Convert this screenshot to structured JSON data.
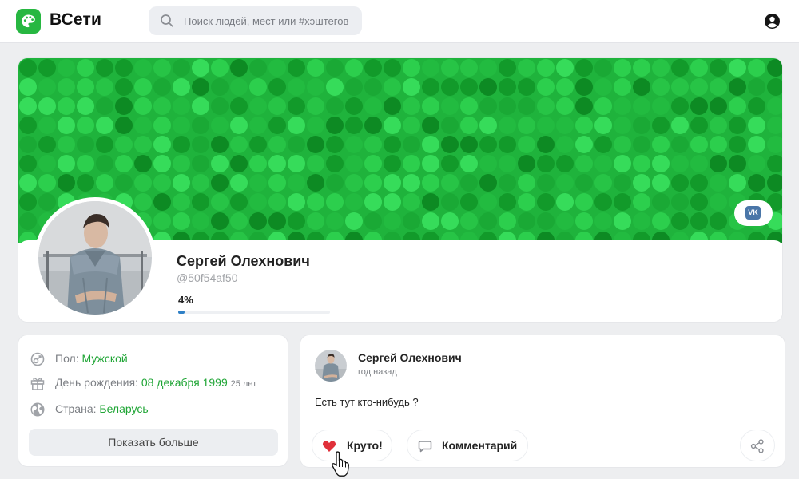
{
  "app": {
    "name": "ВСети"
  },
  "header": {
    "search_placeholder": "Поиск людей, мест или #хэштегов",
    "logo_icon": "palette-icon",
    "user_icon": "account-circle-icon"
  },
  "profile": {
    "name": "Сергей Олехнович",
    "handle": "@50f54af50",
    "completion_label": "4%",
    "completion": 0.04,
    "social_icon": "vk-icon"
  },
  "info": {
    "gender_label": "Пол:",
    "gender_value": "Мужской",
    "birthday_label": "День рождения:",
    "birthday_value": "08 декабря 1999",
    "age": "25 лет",
    "country_label": "Страна:",
    "country_value": "Беларусь",
    "show_more": "Показать больше",
    "icons": [
      "gender-icon",
      "gift-icon",
      "globe-icon"
    ]
  },
  "post": {
    "author": "Сергей Олехнович",
    "time": "год назад",
    "text": "Есть тут кто-нибудь ?",
    "like_label": "Круто!",
    "comment_label": "Комментарий",
    "icons": [
      "heart-icon",
      "comment-icon",
      "share-icon"
    ]
  },
  "colors": {
    "accent": "#27b741",
    "cover": "#1fb33c",
    "link_green": "#1fa535",
    "progress": "#2f80c6",
    "vk": "#4a76a8",
    "heart": "#e0303a"
  }
}
